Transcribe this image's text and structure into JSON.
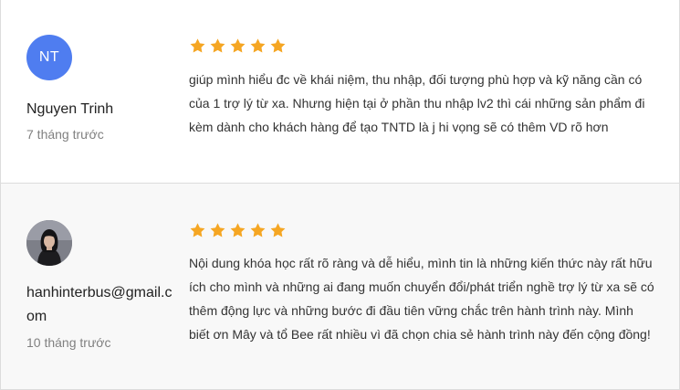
{
  "colors": {
    "star": "#f5a623",
    "avatar_initials_bg": "#4f7df0",
    "name_text": "#222222",
    "time_text": "#808080"
  },
  "reviews": [
    {
      "avatar": {
        "type": "initials",
        "initials": "NT"
      },
      "name": "Nguyen Trinh",
      "time": "7 tháng trước",
      "rating": 5,
      "text": "giúp mình hiểu đc về khái niệm, thu nhập, đối tượng phù hợp và kỹ năng cần có của 1 trợ lý từ xa. Nhưng hiện tại ở phần thu nhập lv2 thì cái những sản phẩm đi kèm dành cho khách hàng để tạo TNTD là j hi vọng sẽ có thêm VD rõ hơn"
    },
    {
      "avatar": {
        "type": "photo",
        "icon": "user-photo-avatar"
      },
      "name": "hanhinterbus@gmail.com",
      "time": "10 tháng trước",
      "rating": 5,
      "text": "Nội dung khóa học rất rõ ràng và dễ hiểu, mình tin là những kiến thức này rất hữu ích cho mình và những ai đang muốn chuyển đổi/phát triển nghề trợ lý từ xa sẽ có thêm động lực và những bước đi đầu tiên vững chắc trên hành trình này. Mình biết ơn Mây và tổ Bee rất nhiều vì đã chọn chia sẻ hành trình này đến cộng đồng!"
    }
  ]
}
